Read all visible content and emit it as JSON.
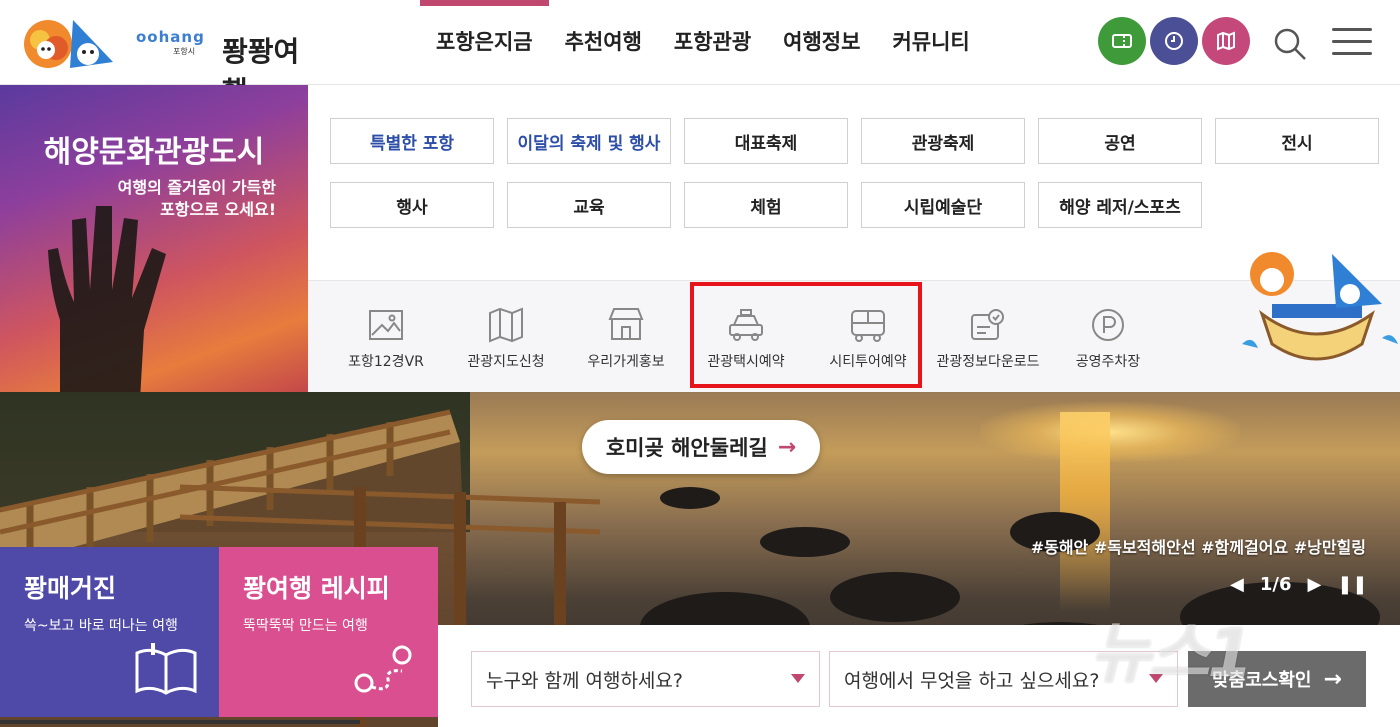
{
  "header": {
    "logo_en": "oohang",
    "logo_sub": "포항시",
    "logo_name": "퐝퐝여행",
    "nav": [
      {
        "label": "포항은지금",
        "active": true
      },
      {
        "label": "추천여행",
        "active": false
      },
      {
        "label": "포항관광",
        "active": false
      },
      {
        "label": "여행정보",
        "active": false
      },
      {
        "label": "커뮤니티",
        "active": false
      }
    ],
    "circle_buttons": [
      {
        "icon": "ticket-icon",
        "color": "#3f9b3a"
      },
      {
        "icon": "clock-icon",
        "color": "#4a4f96"
      },
      {
        "icon": "map-icon",
        "color": "#c4497a"
      }
    ]
  },
  "promo": {
    "title": "해양문화관광도시",
    "sub_line1": "여행의 즐거움이 가득한",
    "sub_line2": "포항으로 오세요!"
  },
  "categories": [
    {
      "label": "특별한 포항",
      "style": "blue"
    },
    {
      "label": "이달의 축제 및 행사",
      "style": "blue"
    },
    {
      "label": "대표축제",
      "style": "normal"
    },
    {
      "label": "관광축제",
      "style": "normal"
    },
    {
      "label": "공연",
      "style": "normal"
    },
    {
      "label": "전시",
      "style": "normal"
    },
    {
      "label": "행사",
      "style": "normal"
    },
    {
      "label": "교육",
      "style": "normal"
    },
    {
      "label": "체험",
      "style": "normal"
    },
    {
      "label": "시립예술단",
      "style": "normal"
    },
    {
      "label": "해양 레저/스포츠",
      "style": "normal"
    }
  ],
  "quick_menu": [
    {
      "label": "포항12경VR",
      "icon": "image-frame-icon"
    },
    {
      "label": "관광지도신청",
      "icon": "folded-map-icon"
    },
    {
      "label": "우리가게홍보",
      "icon": "store-icon"
    },
    {
      "label": "관광택시예약",
      "icon": "taxi-icon"
    },
    {
      "label": "시티투어예약",
      "icon": "bus-icon"
    },
    {
      "label": "관광정보다운로드",
      "icon": "download-card-icon"
    },
    {
      "label": "공영주차장",
      "icon": "parking-icon"
    }
  ],
  "banner": {
    "title": "호미곶 해안둘레길",
    "arrow": "→",
    "hashtags": "#동해안 #독보적해안선 #함께걸어요 #낭만힐링",
    "page_current": "1",
    "page_total": "6",
    "pager_text": "1/6"
  },
  "cards": [
    {
      "title": "퐝매거진",
      "sub": "쓱~보고 바로 떠나는 여행",
      "icon": "open-book-icon"
    },
    {
      "title": "퐝여행 레시피",
      "sub": "뚝딱뚝딱 만드는 여행",
      "icon": "route-pin-icon"
    }
  ],
  "search": {
    "who_placeholder": "누구와 함께 여행하세요?",
    "what_placeholder": "여행에서 무엇을 하고 싶으세요?",
    "confirm_label": "맞춤코스확인",
    "confirm_arrow": "→"
  },
  "watermark": "뉴스1",
  "colors": {
    "accent_pink": "#c0486e",
    "highlight_red": "#e8141c",
    "card_purple": "#4f4aa8",
    "card_pink": "#d94f8f",
    "category_blue": "#2d4ea8"
  }
}
